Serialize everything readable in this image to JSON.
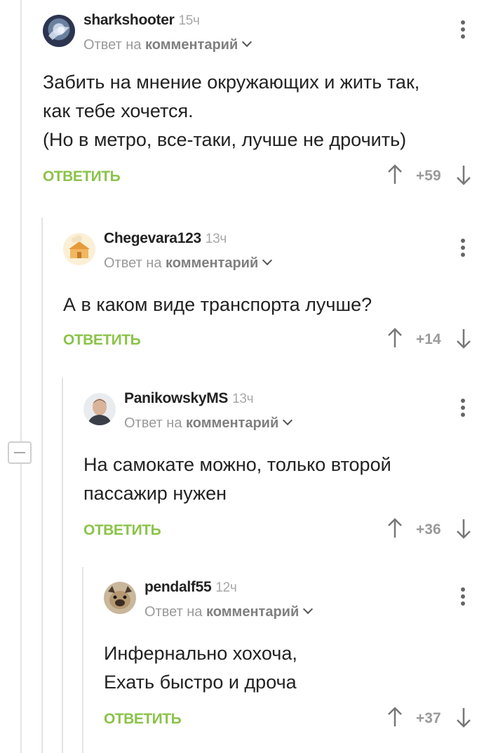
{
  "comments": [
    {
      "username": "sharkshooter",
      "time": "15ч",
      "reply_prefix": "Ответ на",
      "reply_target": "комментарий",
      "lines": [
        "Забить на мнение окружающих и жить так,",
        "как тебе хочется.",
        "(Но в метро, все-таки, лучше не дрочить)"
      ],
      "reply_label": "ОТВЕТИТЬ",
      "rating": "+59"
    },
    {
      "username": "Chegevara123",
      "time": "13ч",
      "reply_prefix": "Ответ на",
      "reply_target": "комментарий",
      "lines": [
        "А в каком виде транспорта лучше?"
      ],
      "reply_label": "ОТВЕТИТЬ",
      "rating": "+14"
    },
    {
      "username": "PanikowskyMS",
      "time": "13ч",
      "reply_prefix": "Ответ на",
      "reply_target": "комментарий",
      "lines": [
        "На самокате можно, только второй",
        "пассажир нужен"
      ],
      "reply_label": "ОТВЕТИТЬ",
      "rating": "+36"
    },
    {
      "username": "pendalf55",
      "time": "12ч",
      "reply_prefix": "Ответ на",
      "reply_target": "комментарий",
      "lines": [
        "Инфернально хохоча,",
        "Ехать быстро и дроча"
      ],
      "reply_label": "ОТВЕТИТЬ",
      "rating": "+37"
    }
  ],
  "icons": {
    "collapse": "minus-icon",
    "more": "kebab-menu-icon",
    "upvote": "arrow-up-icon",
    "downvote": "arrow-down-icon",
    "expand": "chevron-down-icon"
  },
  "colors": {
    "accent": "#8bc34a",
    "muted": "#9a9a9a",
    "thread_line": "#e4e4e4"
  }
}
